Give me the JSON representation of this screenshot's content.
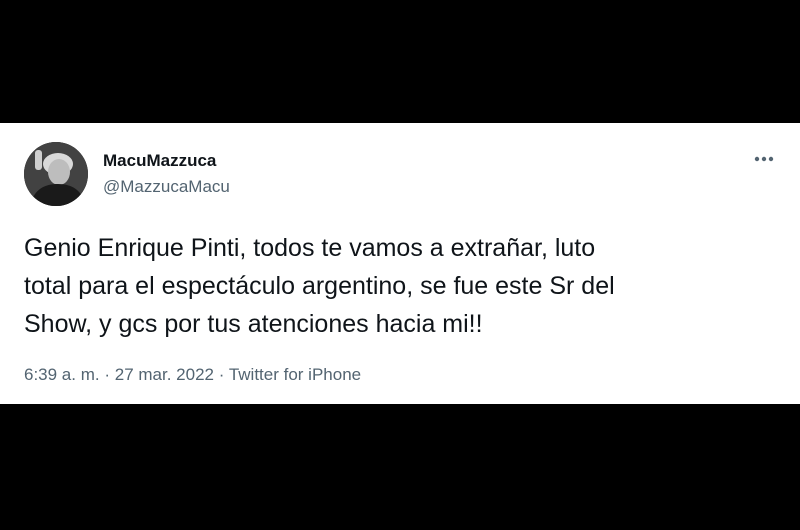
{
  "tweet": {
    "author": {
      "display_name": "MacuMazzuca",
      "handle": "@MazzucaMacu",
      "avatar_icon": "profile-photo"
    },
    "more_icon": "more-horizontal-icon",
    "text": "Genio Enrique Pinti, todos te vamos a extrañar, luto\ntotal para el espectáculo argentino, se fue este Sr del\nShow, y gcs por tus atenciones hacia mi!!",
    "time": "6:39 a. m.",
    "separator": "·",
    "date": "27 mar. 2022",
    "source": "Twitter for iPhone"
  },
  "colors": {
    "background": "#000000",
    "card": "#ffffff",
    "text_primary": "#0f1419",
    "text_secondary": "#536471"
  }
}
